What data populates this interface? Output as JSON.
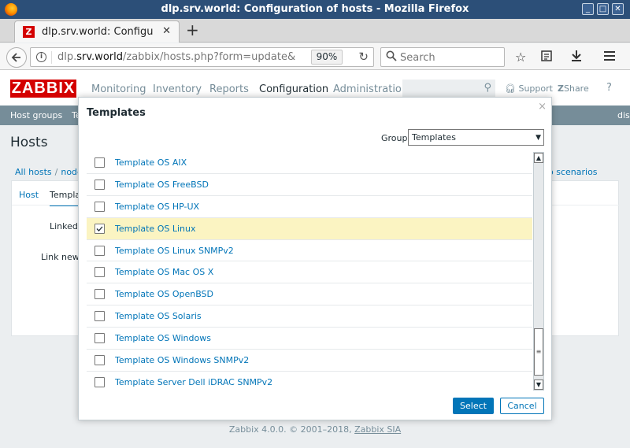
{
  "window": {
    "title": "dlp.srv.world: Configuration of hosts - Mozilla Firefox",
    "minimize": "_",
    "maximize": "□",
    "close": "✕"
  },
  "browser": {
    "tab_title": "dlp.srv.world: Configu",
    "tab_favicon": "Z",
    "tab_close": "✕",
    "new_tab": "+",
    "url_host": "dlp.srv.world",
    "url_path": "/zabbix/hosts.php?form=update&",
    "url_prefix": "dlp.",
    "url_domain": "srv.world",
    "zoom": "90%",
    "search_placeholder": "Search"
  },
  "zabbix": {
    "logo": "ZABBIX",
    "menu": [
      "Monitoring",
      "Inventory",
      "Reports",
      "Configuration",
      "Administration"
    ],
    "support": "Support",
    "share": "Share",
    "help": "?",
    "subnav": [
      "Host groups",
      "Te"
    ],
    "subnav_right": "dis",
    "page_title": "Hosts",
    "breadcrumbs": [
      "All hosts",
      "node"
    ],
    "right_link": "Web scenarios",
    "right_link_visible": "o scenarios",
    "tabs": [
      "Host",
      "Templa"
    ],
    "labels": [
      "Linked t",
      "Link new t"
    ],
    "footer_text": "Zabbix 4.0.0. © 2001–2018, ",
    "footer_link": "Zabbix SIA"
  },
  "modal": {
    "title": "Templates",
    "close": "×",
    "group_label": "Group",
    "group_value": "Templates",
    "templates": [
      {
        "name": "Template OS AIX",
        "checked": false
      },
      {
        "name": "Template OS FreeBSD",
        "checked": false
      },
      {
        "name": "Template OS HP-UX",
        "checked": false
      },
      {
        "name": "Template OS Linux",
        "checked": true
      },
      {
        "name": "Template OS Linux SNMPv2",
        "checked": false
      },
      {
        "name": "Template OS Mac OS X",
        "checked": false
      },
      {
        "name": "Template OS OpenBSD",
        "checked": false
      },
      {
        "name": "Template OS Solaris",
        "checked": false
      },
      {
        "name": "Template OS Windows",
        "checked": false
      },
      {
        "name": "Template OS Windows SNMPv2",
        "checked": false
      },
      {
        "name": "Template Server Dell iDRAC SNMPv2",
        "checked": false
      }
    ],
    "select_button": "Select",
    "cancel_button": "Cancel"
  },
  "colors": {
    "zabbix_red": "#d40000",
    "link_blue": "#0275b8",
    "selected_row": "#fbf4c2",
    "subnav_bg": "#768d99",
    "titlebar_bg": "#2c4f78"
  }
}
